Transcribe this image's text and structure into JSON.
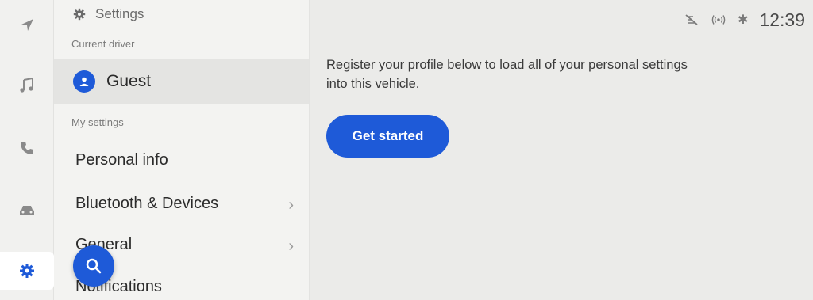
{
  "rail": {
    "items": [
      {
        "icon": "navigation-icon"
      },
      {
        "icon": "music-icon"
      },
      {
        "icon": "phone-icon"
      },
      {
        "icon": "car-icon"
      },
      {
        "icon": "gear-icon",
        "active": true
      }
    ]
  },
  "menu": {
    "header_title": "Settings",
    "current_driver_label": "Current driver",
    "driver_name": "Guest",
    "my_settings_label": "My settings",
    "items": [
      {
        "label": "Personal info"
      },
      {
        "label": "Bluetooth & Devices",
        "has_chevron": true
      },
      {
        "label": "General",
        "has_chevron": true
      },
      {
        "label": "Notifications"
      }
    ],
    "chevron": "›"
  },
  "status_bar": {
    "icons": [
      "voice-off-icon",
      "wireless-signal-icon",
      "bluetooth-icon"
    ],
    "bluetooth_glyph": "✱",
    "time": "12:39"
  },
  "main": {
    "message": "Register your profile below to load all of your personal settings into this vehicle.",
    "cta_label": "Get started"
  },
  "colors": {
    "accent": "#1e5ad8",
    "background": "#ebebe9",
    "sidebar": "#f3f3f1",
    "selected_row": "#e4e4e2"
  }
}
